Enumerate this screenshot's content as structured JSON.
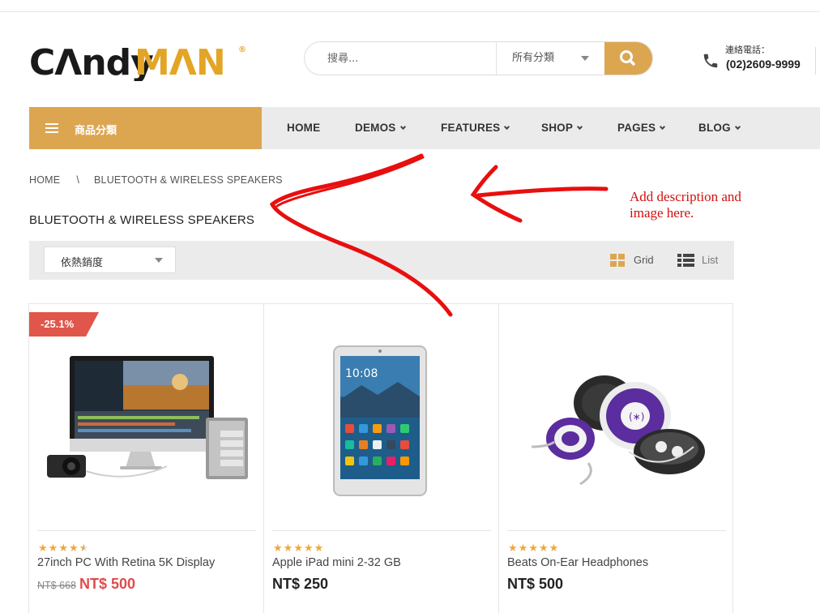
{
  "header": {
    "logo_text_black": "CΛndy",
    "logo_text_gold": "MΛN",
    "logo_mark": "®",
    "search": {
      "placeholder": "搜尋...",
      "category": "所有分類"
    },
    "contact": {
      "label": "連絡電話：",
      "number": "(02)2609-9999"
    }
  },
  "nav": {
    "categories_label": "商品分類",
    "items": [
      {
        "label": "HOME",
        "dropdown": false
      },
      {
        "label": "DEMOS",
        "dropdown": true
      },
      {
        "label": "FEATURES",
        "dropdown": true
      },
      {
        "label": "SHOP",
        "dropdown": true
      },
      {
        "label": "PAGES",
        "dropdown": true
      },
      {
        "label": "BLOG",
        "dropdown": true
      }
    ]
  },
  "breadcrumb": {
    "home": "HOME",
    "separator": "\\",
    "current": "BLUETOOTH & WIRELESS SPEAKERS"
  },
  "page_title": "BLUETOOTH & WIRELESS SPEAKERS",
  "annotation": {
    "line1": "Add description and",
    "line2": "image here."
  },
  "toolbar": {
    "sort_label": "依熱銷度",
    "grid_label": "Grid",
    "list_label": "List"
  },
  "products": [
    {
      "name": "27inch PC With Retina 5K Display",
      "rating": 4.5,
      "discount": "-25.1%",
      "old_price": "NT$ 668",
      "price": "NT$ 500",
      "image": "imac-desktop-image"
    },
    {
      "name": "Apple iPad mini 2-32 GB",
      "rating": 5,
      "discount": "",
      "old_price": "",
      "price": "NT$ 250",
      "image": "tablet-image"
    },
    {
      "name": "Beats On-Ear Headphones",
      "rating": 5,
      "discount": "",
      "old_price": "",
      "price": "NT$ 500",
      "image": "earbuds-case-image"
    }
  ],
  "colors": {
    "accent": "#dca651",
    "sale": "#e04b4b",
    "annotation": "#d01010",
    "nav_bg": "#ebebeb"
  }
}
